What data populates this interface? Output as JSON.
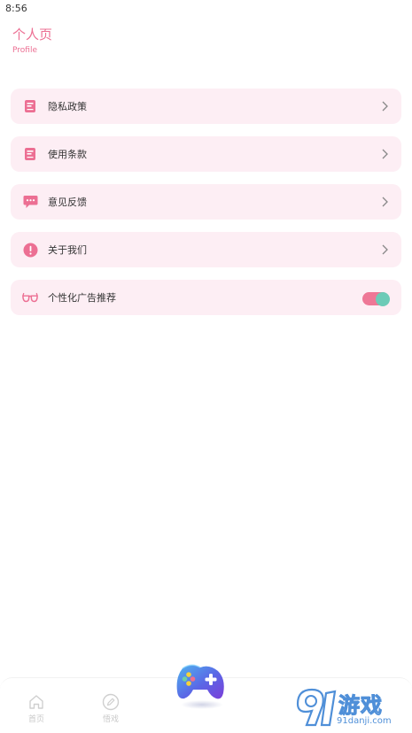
{
  "status_bar": {
    "time": "8:56"
  },
  "header": {
    "title": "个人页",
    "subtitle": "Profile"
  },
  "menu": {
    "items": [
      {
        "label": "隐私政策",
        "icon": "document-icon"
      },
      {
        "label": "使用条款",
        "icon": "document-icon"
      },
      {
        "label": "意见反馈",
        "icon": "chat-bubble-icon"
      },
      {
        "label": "关于我们",
        "icon": "exclamation-icon"
      },
      {
        "label": "个性化广告推荐",
        "icon": "glasses-icon",
        "toggle_on": true
      }
    ]
  },
  "bottom_nav": {
    "items": [
      {
        "label": "首页",
        "icon": "home-icon"
      },
      {
        "label": "悟戏",
        "icon": "pencil-icon"
      }
    ],
    "center_icon": "gamepad-icon"
  },
  "watermark": {
    "brand": "游戏",
    "site": "91danji.com"
  },
  "colors": {
    "accent_pink": "#ec6f93",
    "card_background": "#fdeef4",
    "toggle_track": "#ee7796",
    "toggle_knob": "#6ccbb7"
  }
}
